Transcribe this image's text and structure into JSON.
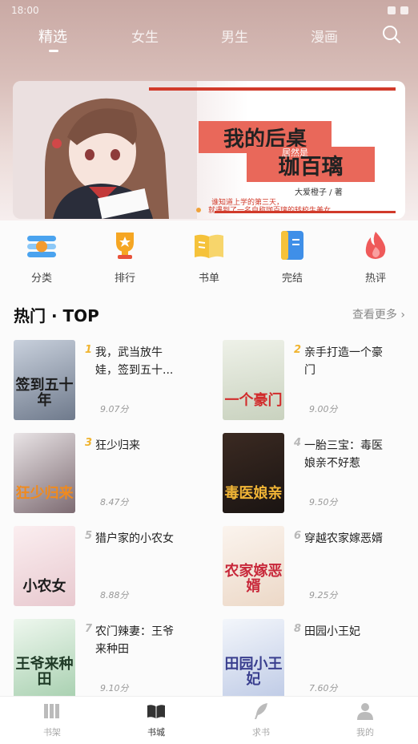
{
  "status_bar": {
    "left": "18:00"
  },
  "top_tabs": [
    {
      "label": "精选",
      "active": true
    },
    {
      "label": "女生",
      "active": false
    },
    {
      "label": "男生",
      "active": false
    },
    {
      "label": "漫画",
      "active": false
    }
  ],
  "banner": {
    "title_line1": "我的后桌",
    "subtitle": "居然是",
    "title_line2": "珈百璃",
    "author": "大爱橙子 / 著",
    "desc_line1": "谁知道上学的第三天，",
    "desc_line2": "就遇到了一名自称珈百璃的转校生美女"
  },
  "quick_links": [
    {
      "label": "分类",
      "icon": "category-icon"
    },
    {
      "label": "排行",
      "icon": "trophy-icon"
    },
    {
      "label": "书单",
      "icon": "booklist-icon"
    },
    {
      "label": "完结",
      "icon": "finished-book-icon"
    },
    {
      "label": "热评",
      "icon": "flame-icon"
    }
  ],
  "section": {
    "title": "热门 · TOP",
    "more": "查看更多"
  },
  "books": [
    {
      "rank": "1",
      "name": "我，武当放牛娃，签到五十...",
      "score": "9.07分",
      "cover_title": "签到五十年",
      "cover_bg": "#9aa6b8"
    },
    {
      "rank": "2",
      "name": "亲手打造一个豪门",
      "score": "9.00分",
      "cover_title": "一个豪门",
      "cover_bg": "#dfe3d6"
    },
    {
      "rank": "3",
      "name": "狂少归来",
      "score": "8.47分",
      "cover_title": "狂少归来",
      "cover_bg": "#8b7f86"
    },
    {
      "rank": "4",
      "name": "一胎三宝：毒医娘亲不好惹",
      "score": "9.50分",
      "cover_title": "毒医娘亲",
      "cover_bg": "#2a1f1c"
    },
    {
      "rank": "5",
      "name": "猎户家的小农女",
      "score": "8.88分",
      "cover_title": "小农女",
      "cover_bg": "#f1dfe2"
    },
    {
      "rank": "6",
      "name": "穿越农家嫁恶婿",
      "score": "9.25分",
      "cover_title": "农家嫁恶婿",
      "cover_bg": "#f6ece3"
    },
    {
      "rank": "7",
      "name": "农门辣妻：王爷来种田",
      "score": "9.10分",
      "cover_title": "王爷来种田",
      "cover_bg": "#d9ecd8"
    },
    {
      "rank": "8",
      "name": "田园小王妃",
      "score": "7.60分",
      "cover_title": "田园小王妃",
      "cover_bg": "#e3e9f4"
    }
  ],
  "tab_bar": [
    {
      "label": "书架",
      "active": false
    },
    {
      "label": "书城",
      "active": true
    },
    {
      "label": "求书",
      "active": false
    },
    {
      "label": "我的",
      "active": false
    }
  ]
}
